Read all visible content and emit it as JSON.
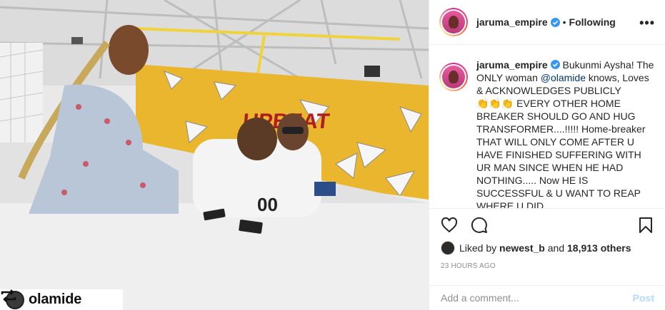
{
  "post": {
    "username": "jaruma_empire",
    "follow_status": "Following",
    "separator": "•",
    "more": "•••"
  },
  "caption": {
    "username": "jaruma_empire",
    "part1": " Bukunmi Aysha! The ONLY woman ",
    "mention": "@olamide",
    "part2": " knows, Loves & ACKNOWLEDGES PUBLICLY ",
    "emoji": "👏👏👏",
    "part3": " EVERY OTHER HOME BREAKER SHOULD GO AND HUG TRANSFORMER....!!!!! Home-breaker THAT WILL ONLY COME AFTER U HAVE FINISHED SUFFERING WITH UR MAN SINCE WHEN HE HAD NOTHING..... Now HE IS SUCCESSFUL & U WANT TO REAP WHERE U DID"
  },
  "likes": {
    "prefix": "Liked by ",
    "user": "newest_b",
    "middle": " and ",
    "count": "18,913 others"
  },
  "timestamp": "23 HOURS AGO",
  "comment": {
    "placeholder": "Add a comment...",
    "post_label": "Post"
  },
  "photo": {
    "repost_user": "olamide",
    "wall_text": "UPBEAT",
    "jersey_number": "00"
  },
  "colors": {
    "link": "#00376b",
    "post_disabled": "#b3dbff",
    "verified": "#3897f0",
    "wall": "#e9b62e"
  },
  "icons": [
    "more-icon",
    "verified-icon",
    "heart-icon",
    "comment-icon",
    "save-icon",
    "repost-icon"
  ]
}
